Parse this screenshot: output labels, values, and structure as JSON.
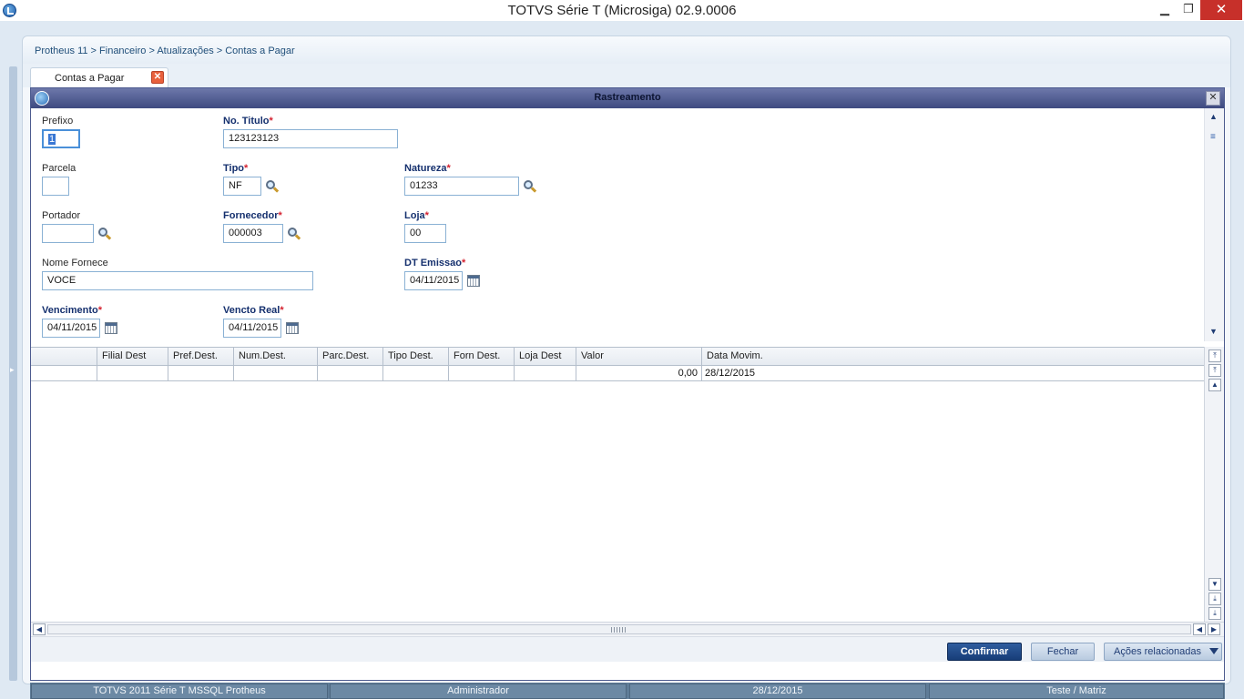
{
  "window": {
    "title": "TOTVS Série T  (Microsiga) 02.9.0006",
    "minimize": "▁",
    "maximize": "❐",
    "close": "✕"
  },
  "breadcrumb": "Protheus 11 > Financeiro > Atualizações > Contas a Pagar",
  "tab": {
    "label": "Contas a Pagar",
    "close": "✕"
  },
  "dialog": {
    "title": "Rastreamento",
    "close": "✕"
  },
  "form": {
    "prefixo": {
      "label": "Prefixo",
      "value": "1"
    },
    "no_titulo": {
      "label": "No. Titulo",
      "value": "123123123"
    },
    "parcela": {
      "label": "Parcela",
      "value": ""
    },
    "tipo": {
      "label": "Tipo",
      "value": "NF"
    },
    "natureza": {
      "label": "Natureza",
      "value": "01233"
    },
    "portador": {
      "label": "Portador",
      "value": ""
    },
    "fornecedor": {
      "label": "Fornecedor",
      "value": "000003"
    },
    "loja": {
      "label": "Loja",
      "value": "00"
    },
    "nome_fornece": {
      "label": "Nome Fornece",
      "value": "VOCE"
    },
    "dt_emissao": {
      "label": "DT Emissao",
      "value": "04/11/2015"
    },
    "vencimento": {
      "label": "Vencimento",
      "value": "04/11/2015"
    },
    "vencto_real": {
      "label": "Vencto Real",
      "value": "04/11/2015"
    },
    "required_mark": "*"
  },
  "grid": {
    "columns": [
      "",
      "Filial Dest",
      "Pref.Dest.",
      "Num.Dest.",
      "Parc.Dest.",
      "Tipo Dest.",
      "Forn Dest.",
      "Loja Dest",
      "Valor",
      "Data Movim."
    ],
    "rows": [
      [
        "",
        "",
        "",
        "",
        "",
        "",
        "",
        "",
        "0,00",
        "28/12/2015"
      ]
    ]
  },
  "scroll": {
    "up": "▲",
    "down": "▼",
    "top": "⤒",
    "bottom": "⤓",
    "left": "◀",
    "right": "▶",
    "thumb": "≡"
  },
  "buttons": {
    "confirmar": "Confirmar",
    "fechar": "Fechar",
    "acoes": "Ações relacionadas"
  },
  "status": {
    "system": "TOTVS 2011 Série T  MSSQL Protheus",
    "user": "Administrador",
    "date": "28/12/2015",
    "branch": "Teste / Matriz"
  },
  "colors": {
    "dialog_header": "#3e4a80",
    "required": "#d4212f",
    "primary_button": "#173d78",
    "statusbar": "#5f7c97"
  },
  "icons": [
    "app-icon",
    "close-icon",
    "search-icon",
    "calendar-icon",
    "scroll-up-icon",
    "scroll-down-icon",
    "dropdown-caret-icon"
  ]
}
